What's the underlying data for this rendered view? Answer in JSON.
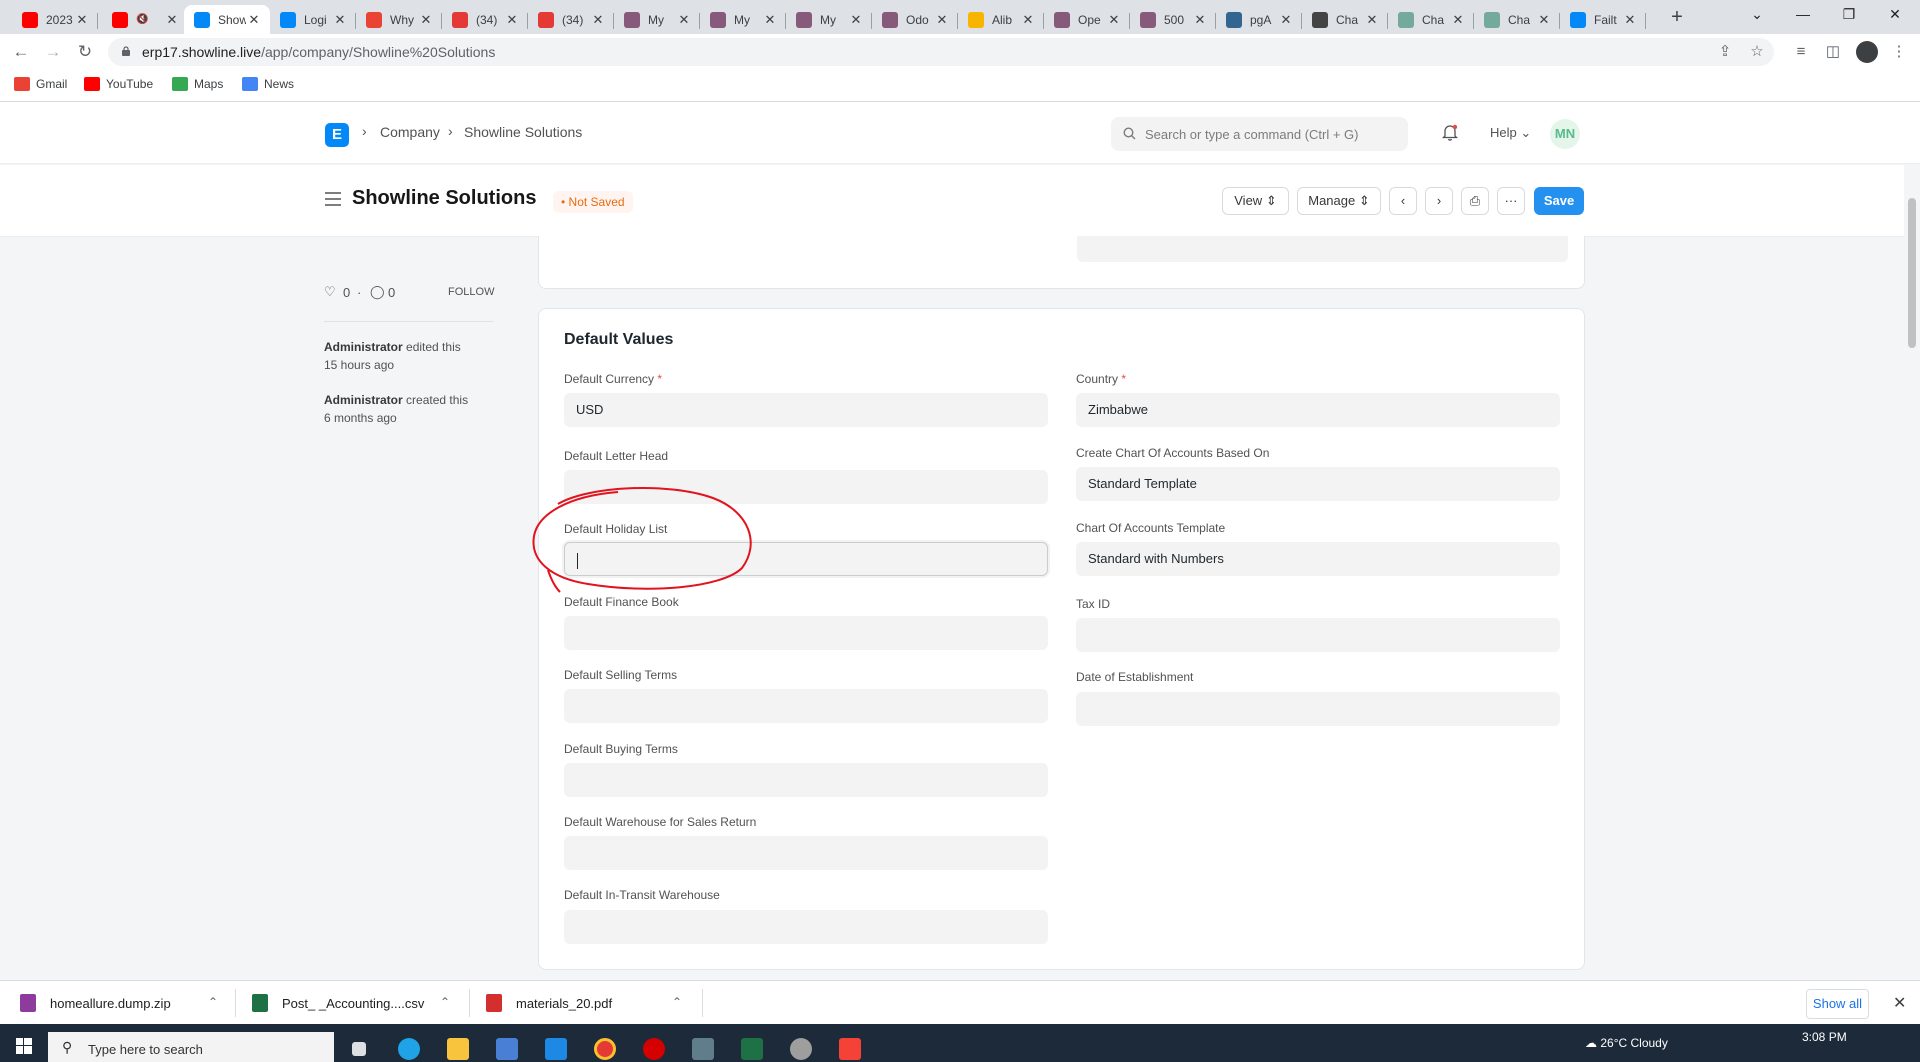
{
  "browser": {
    "tabs": [
      {
        "title": "2023",
        "favicon": "youtube-icon",
        "color": "#ff0000"
      },
      {
        "title": "",
        "favicon": "youtube-icon",
        "color": "#ff0000",
        "muted": true
      },
      {
        "title": "Show",
        "favicon": "erpnext-icon",
        "color": "#0289f7",
        "active": true
      },
      {
        "title": "Logi",
        "favicon": "erpnext-icon",
        "color": "#0289f7"
      },
      {
        "title": "Why",
        "favicon": "gmail-icon",
        "color": "#ea4335"
      },
      {
        "title": "(34)",
        "favicon": "g-icon",
        "color": "#e53935"
      },
      {
        "title": "(34)",
        "favicon": "g-icon",
        "color": "#e53935"
      },
      {
        "title": "My",
        "favicon": "odoo-icon",
        "color": "#875a7b"
      },
      {
        "title": "My",
        "favicon": "odoo-icon",
        "color": "#875a7b"
      },
      {
        "title": "My",
        "favicon": "odoo-icon",
        "color": "#875a7b"
      },
      {
        "title": "Odo",
        "favicon": "odoo-icon",
        "color": "#875a7b"
      },
      {
        "title": "Alib",
        "favicon": "alibaba-icon",
        "color": "#f7b500"
      },
      {
        "title": "Ope",
        "favicon": "odoo-icon",
        "color": "#875a7b"
      },
      {
        "title": "500",
        "favicon": "odoo-icon",
        "color": "#875a7b"
      },
      {
        "title": "pgA",
        "favicon": "pgadmin-icon",
        "color": "#326690"
      },
      {
        "title": "Cha",
        "favicon": "openai-icon",
        "color": "#444444"
      },
      {
        "title": "Cha",
        "favicon": "chatgpt-icon",
        "color": "#74aa9c"
      },
      {
        "title": "Cha",
        "favicon": "chatgpt-icon",
        "color": "#74aa9c"
      },
      {
        "title": "Failt",
        "favicon": "frappe-icon",
        "color": "#0289f7"
      }
    ],
    "url_host": "erp17.showline.live",
    "url_path": "/app/company/Showline%20Solutions",
    "bookmarks": [
      {
        "label": "Gmail",
        "icon": "gmail-icon",
        "color": "#ea4335"
      },
      {
        "label": "YouTube",
        "icon": "youtube-icon",
        "color": "#ff0000"
      },
      {
        "label": "Maps",
        "icon": "maps-icon",
        "color": "#34a853"
      },
      {
        "label": "News",
        "icon": "news-icon",
        "color": "#4285f4"
      }
    ]
  },
  "navbar": {
    "logo": "E",
    "breadcrumbs": [
      "Company",
      "Showline Solutions"
    ],
    "search_placeholder": "Search or type a command (Ctrl + G)",
    "help_label": "Help",
    "avatar_initials": "MN"
  },
  "page": {
    "title": "Showline Solutions",
    "status": "Not Saved",
    "view_label": "View",
    "manage_label": "Manage",
    "save_label": "Save"
  },
  "sidebar": {
    "likes": "0",
    "comments": "0",
    "follow_label": "FOLLOW",
    "timeline": [
      {
        "user": "Administrator",
        "action": "edited this",
        "when": "15 hours ago"
      },
      {
        "user": "Administrator",
        "action": "created this",
        "when": "6 months ago"
      }
    ]
  },
  "section": {
    "title": "Default Values",
    "left_fields": [
      {
        "label": "Default Currency",
        "required": true,
        "value": "USD"
      },
      {
        "label": "Default Letter Head",
        "required": false,
        "value": ""
      },
      {
        "label": "Default Holiday List",
        "required": false,
        "value": "",
        "focused": true
      },
      {
        "label": "Default Finance Book",
        "required": false,
        "value": ""
      },
      {
        "label": "Default Selling Terms",
        "required": false,
        "value": ""
      },
      {
        "label": "Default Buying Terms",
        "required": false,
        "value": ""
      },
      {
        "label": "Default Warehouse for Sales Return",
        "required": false,
        "value": ""
      },
      {
        "label": "Default In-Transit Warehouse",
        "required": false,
        "value": ""
      }
    ],
    "right_fields": [
      {
        "label": "Country",
        "required": true,
        "value": "Zimbabwe"
      },
      {
        "label": "Create Chart Of Accounts Based On",
        "required": false,
        "value": "Standard Template"
      },
      {
        "label": "Chart Of Accounts Template",
        "required": false,
        "value": "Standard with Numbers"
      },
      {
        "label": "Tax ID",
        "required": false,
        "value": ""
      },
      {
        "label": "Date of Establishment",
        "required": false,
        "value": ""
      }
    ]
  },
  "downloads": [
    {
      "name": "homeallure.dump.zip",
      "icon": "archive-icon",
      "color": "#8e3b9e"
    },
    {
      "name": "Post_ _Accounting....csv",
      "icon": "excel-icon",
      "color": "#1e7145"
    },
    {
      "name": "materials_20.pdf",
      "icon": "pdf-icon",
      "color": "#d32f2f"
    }
  ],
  "downloads_show_all": "Show all",
  "taskbar": {
    "search_placeholder": "Type here to search",
    "weather": "26°C Cloudy",
    "time": "3:08 PM"
  },
  "colors": {
    "primary": "#2490ef",
    "status_orange": "#e86c13",
    "annotation_red": "#e0141e"
  }
}
